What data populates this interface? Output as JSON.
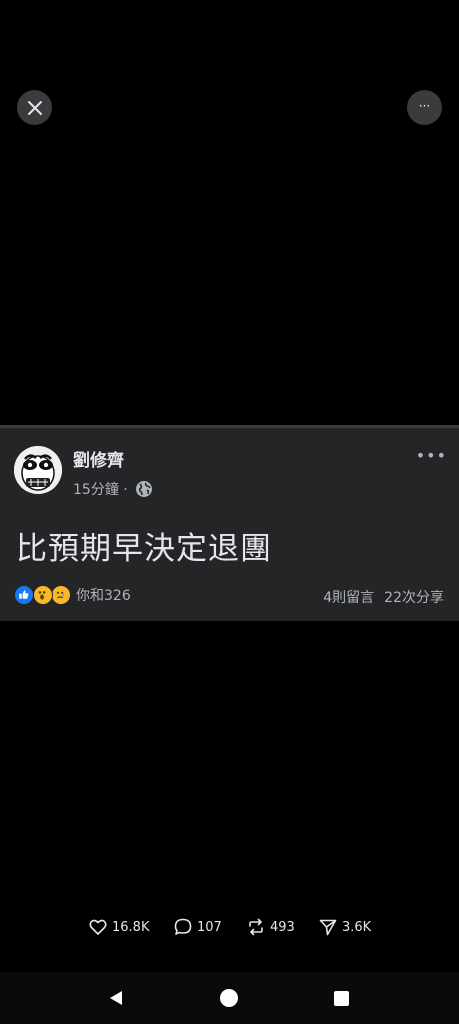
{
  "post": {
    "author": "劉修齊",
    "time": "15分鐘 ·",
    "text": "比預期早決定退團",
    "reactions_text": "你和326",
    "comments": "4則留言",
    "shares": "22次分享",
    "more_icon": "more-horizontal-icon",
    "visibility_icon": "globe-icon"
  },
  "actions": {
    "likes": "16.8K",
    "comments": "107",
    "reposts": "493",
    "sends": "3.6K"
  },
  "icons": {
    "close": "close-icon",
    "more": "more-icon"
  },
  "colors": {
    "background": "#000000",
    "card": "#242526",
    "like_blue": "#1877f2",
    "reaction_yellow": "#f7b928",
    "secondary_text": "#b0b3b8"
  }
}
